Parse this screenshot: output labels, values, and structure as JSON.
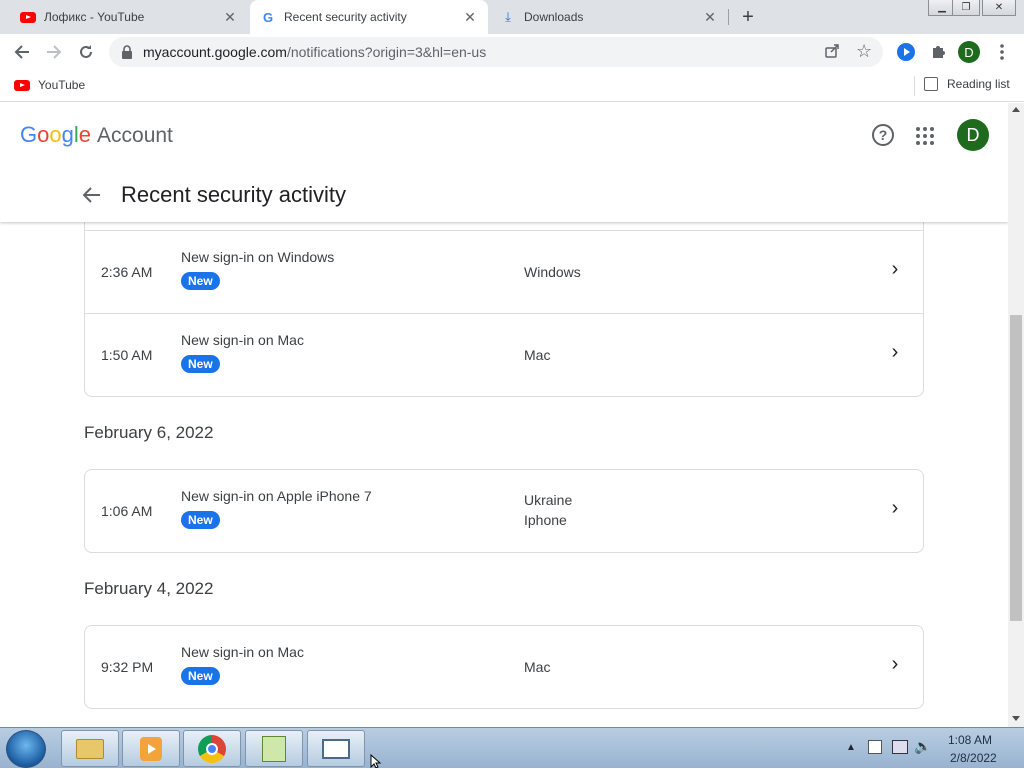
{
  "browser": {
    "tabs": [
      {
        "title": "Лофикс - YouTube",
        "favicon": "youtube-icon",
        "active": false
      },
      {
        "title": "Recent security activity",
        "favicon": "google-icon",
        "active": true
      },
      {
        "title": "Downloads",
        "favicon": "download-icon",
        "active": false
      }
    ],
    "new_tab_glyph": "+",
    "url_host": "myaccount.google.com",
    "url_path": "/notifications?origin=3&hl=en-us",
    "profile_initial": "D",
    "bookmarks": [
      {
        "label": "YouTube",
        "icon": "youtube-icon"
      }
    ],
    "reading_list_label": "Reading list"
  },
  "account_header": {
    "logo_letters": [
      "G",
      "o",
      "o",
      "g",
      "l",
      "e"
    ],
    "logo_product": "Account",
    "help_glyph": "?",
    "avatar_initial": "D",
    "avatar_color": "#1e6b1e",
    "page_title": "Recent security activity"
  },
  "activity": {
    "badge_color": "#1a73e8",
    "groups": [
      {
        "date": "",
        "events": [
          {
            "time": "2:36 AM",
            "title": "New sign-in on Windows",
            "badge": "New",
            "device_lines": [
              "Windows"
            ]
          },
          {
            "time": "1:50 AM",
            "title": "New sign-in on Mac",
            "badge": "New",
            "device_lines": [
              "Mac"
            ]
          }
        ]
      },
      {
        "date": "February 6, 2022",
        "events": [
          {
            "time": "1:06 AM",
            "title": "New sign-in on Apple iPhone 7",
            "badge": "New",
            "device_lines": [
              "Ukraine",
              "Iphone"
            ]
          }
        ]
      },
      {
        "date": "February 4, 2022",
        "events": [
          {
            "time": "9:32 PM",
            "title": "New sign-in on Mac",
            "badge": "New",
            "device_lines": [
              "Mac"
            ]
          }
        ]
      }
    ]
  },
  "taskbar": {
    "apps": [
      "file-explorer-icon",
      "media-player-icon",
      "chrome-icon",
      "notepad-plus-icon",
      "window-app-icon"
    ],
    "clock_time": "1:08 AM",
    "clock_date": "2/8/2022"
  }
}
